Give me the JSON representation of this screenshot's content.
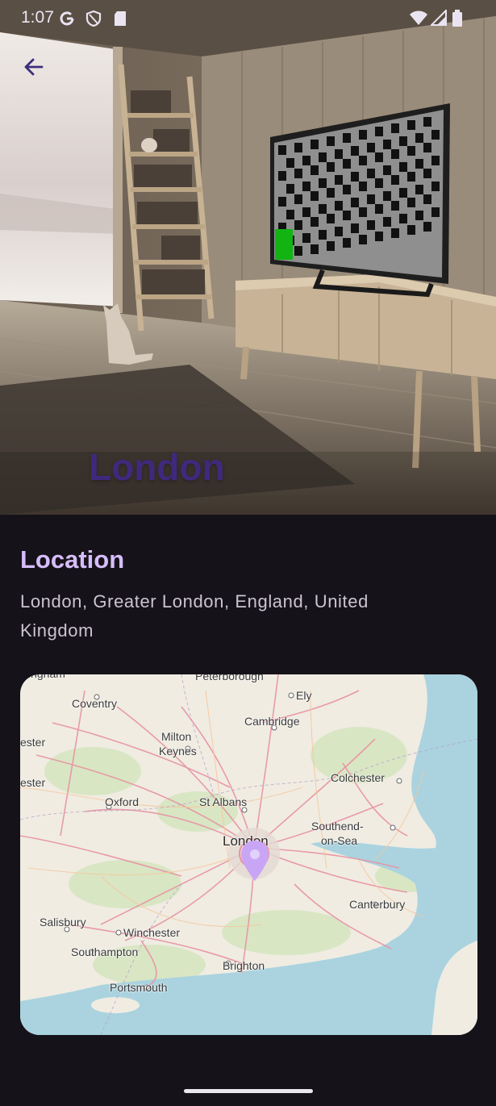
{
  "status_bar": {
    "time": "1:07",
    "left_icons": [
      "google-icon",
      "shield-icon",
      "sd-card-icon"
    ],
    "right_icons": [
      "wifi-icon",
      "signal-icon",
      "battery-icon"
    ]
  },
  "header": {
    "back_icon": "arrow-left-icon",
    "title": "London"
  },
  "location": {
    "heading": "Location",
    "address": "London, Greater London, England, United Kingdom"
  },
  "map": {
    "marker_icon": "map-pin-icon",
    "labels": {
      "peterborough": "Peterborough",
      "ely": "Ely",
      "coventry": "Coventry",
      "cambridge": "Cambridge",
      "milton": "Milton",
      "keynes": "Keynes",
      "colchester": "Colchester",
      "oxford": "Oxford",
      "st_albans": "St Albans",
      "london": "London",
      "southend": "Southend-",
      "on_sea": "on-Sea",
      "canterbury": "Canterbury",
      "salisbury": "Salisbury",
      "winchester": "Winchester",
      "southampton": "Southampton",
      "brighton": "Brighton",
      "portsmouth": "Portsmouth",
      "ester_top": "ester",
      "ester_bottom": "ester",
      "ingham": "ingham"
    }
  },
  "colors": {
    "background": "#161219",
    "accent": "#d6bdfa",
    "title": "#3d2a7d",
    "marker": "#c9a6f5"
  }
}
